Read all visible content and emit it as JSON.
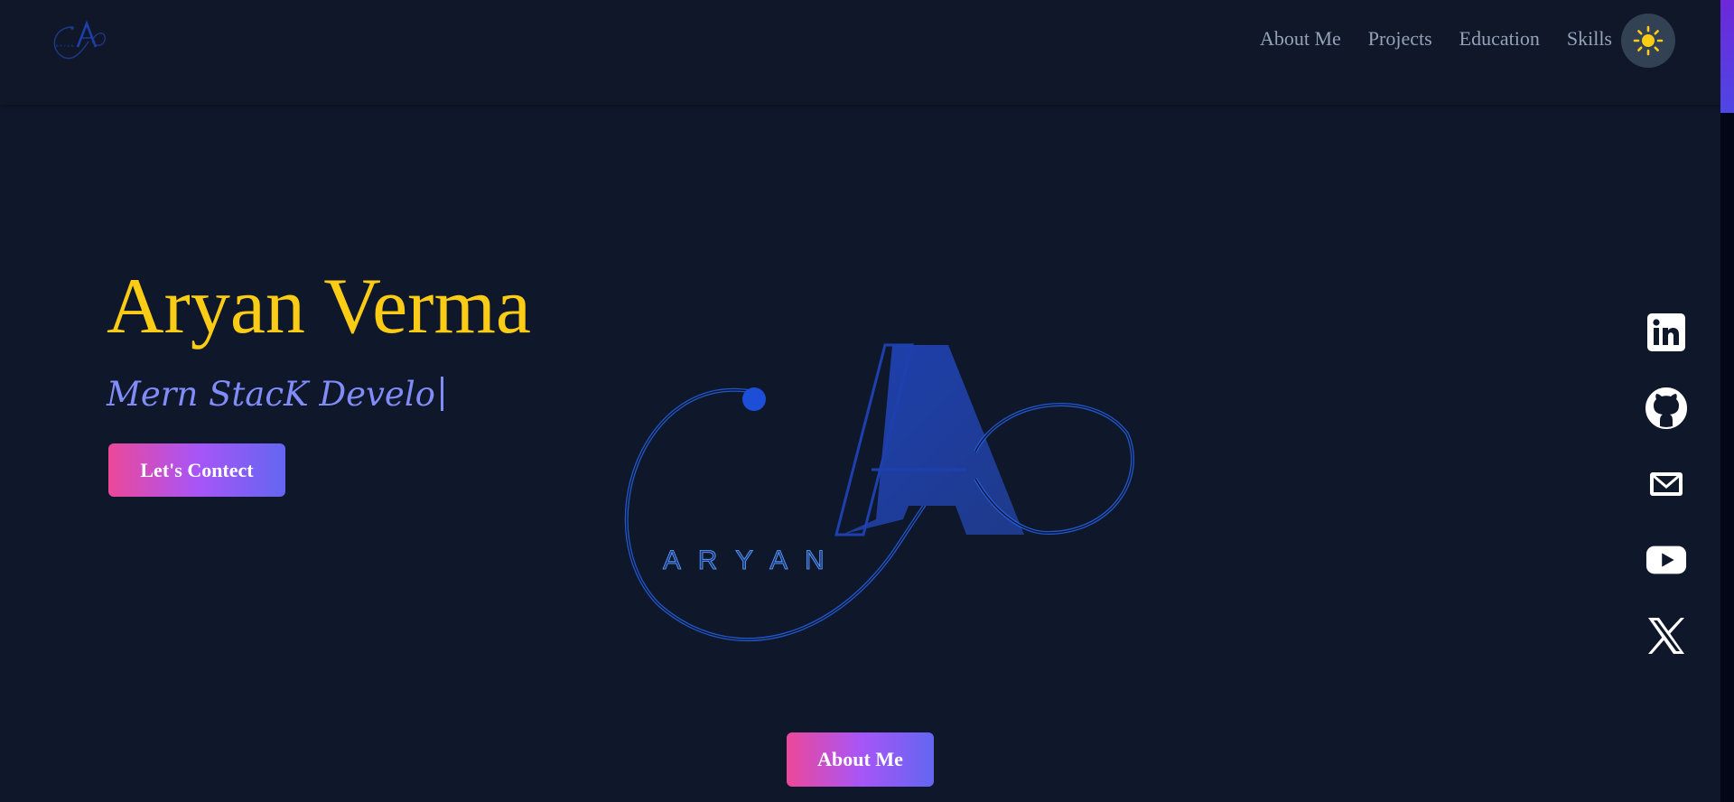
{
  "header": {
    "logo_icon": "aryan-monogram-logo",
    "nav": [
      {
        "label": "About Me"
      },
      {
        "label": "Projects"
      },
      {
        "label": "Education"
      },
      {
        "label": "Skills"
      }
    ],
    "theme_toggle_icon": "sun-icon"
  },
  "hero": {
    "name": "Aryan Verma",
    "role_typed": "Mern StacK Develo",
    "contact_button": "Let's Contect",
    "logo": {
      "monogram": "A",
      "wordmark": "A R Y A N"
    },
    "about_button": "About Me"
  },
  "socials": [
    {
      "icon": "linkedin-icon"
    },
    {
      "icon": "github-icon"
    },
    {
      "icon": "mail-icon"
    },
    {
      "icon": "youtube-icon"
    },
    {
      "icon": "x-twitter-icon"
    }
  ],
  "colors": {
    "background": "#0f172a",
    "name": "#facc15",
    "role": "#818cf8",
    "nav_text": "#94a3b8",
    "logo_blue": "#1e40af",
    "button_gradient": [
      "#ec4899",
      "#a855f7",
      "#6366f1"
    ]
  }
}
